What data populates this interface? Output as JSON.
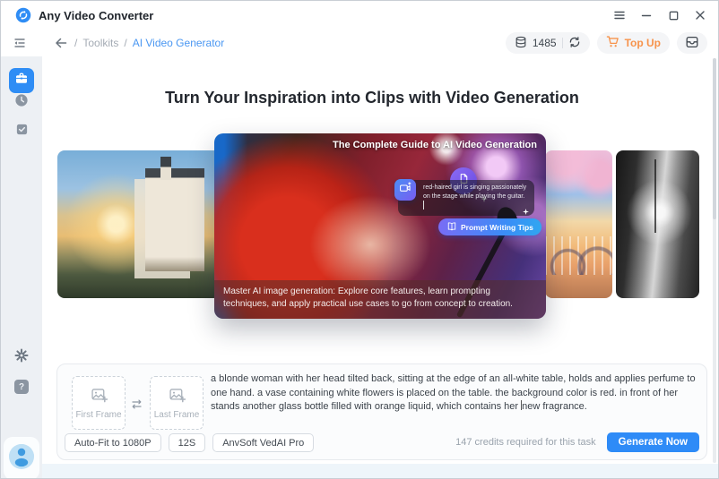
{
  "app": {
    "name": "Any Video Converter"
  },
  "breadcrumb": {
    "separator": "/",
    "toolkits": "Toolkits",
    "current": "AI Video Generator"
  },
  "toolbar": {
    "credits_count": "1485",
    "topup_label": "Top Up"
  },
  "icons": {
    "help_glyph": "?"
  },
  "hero": {
    "heading": "Turn Your Inspiration into Clips with Video Generation"
  },
  "guide_card": {
    "title": "The Complete Guide to AI Video Generation",
    "bubble_text": "red-haired girl is singing passionately on the stage while playing the guitar.",
    "tips_button_label": "Prompt Writing Tips",
    "caption": "Master AI image generation: Explore core features, learn prompting techniques, and apply practical use cases to go from concept to creation."
  },
  "composer": {
    "first_frame_label": "First Frame",
    "last_frame_label": "Last Frame",
    "prompt_before_cursor": "a blonde woman with her head tilted back, sitting at the edge of an all-white table, holds and applies perfume to one hand. a vase containing white flowers is placed on the table. the background color is red. in front of her stands another glass bottle filled with orange liquid, which contains her ",
    "prompt_after_cursor": "new fragrance.",
    "resolution_option": "Auto-Fit to 1080P",
    "duration_option": "12S",
    "model_option": "AnvSoft VedAI Pro",
    "credits_note": "147 credits required for this task",
    "generate_label": "Generate Now"
  },
  "colors": {
    "accent_blue": "#2E8BF7",
    "topup_orange": "#F7934B",
    "breadcrumb_active": "#4A97F2",
    "sidebar_bg": "#EDF0F4"
  }
}
